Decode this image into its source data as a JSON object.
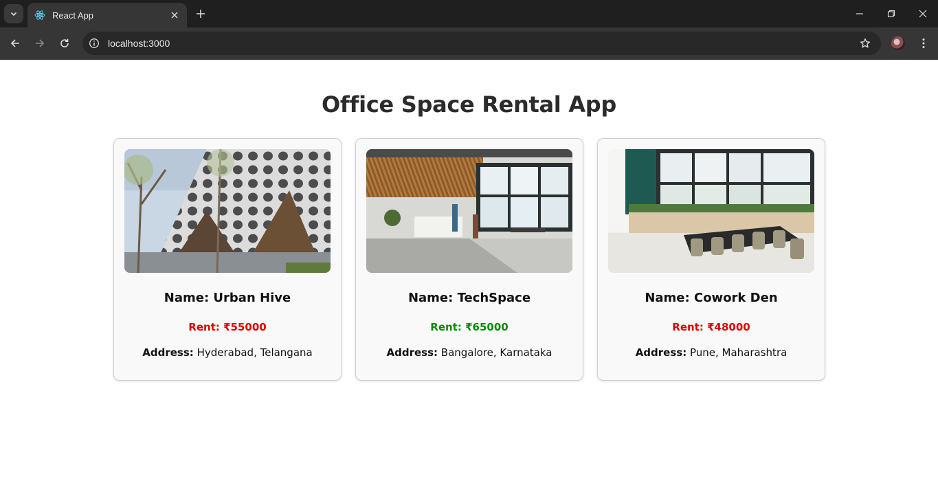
{
  "browser": {
    "tab_title": "React App",
    "url": "localhost:3000"
  },
  "page": {
    "title": "Office Space Rental App"
  },
  "offices": [
    {
      "name": "Name: Urban Hive",
      "rent": "Rent: ₹55000",
      "rent_color": "#e00000",
      "address_label": "Address:",
      "address": "Hyderabad, Telangana",
      "image_icon": "building-facade-image"
    },
    {
      "name": "Name: TechSpace",
      "rent": "Rent: ₹65000",
      "rent_color": "#0a8a0a",
      "address_label": "Address:",
      "address": "Bangalore, Karnataka",
      "image_icon": "office-lobby-image"
    },
    {
      "name": "Name: Cowork Den",
      "rent": "Rent: ₹48000",
      "rent_color": "#e00000",
      "address_label": "Address:",
      "address": "Pune, Maharashtra",
      "image_icon": "meeting-room-image"
    }
  ]
}
